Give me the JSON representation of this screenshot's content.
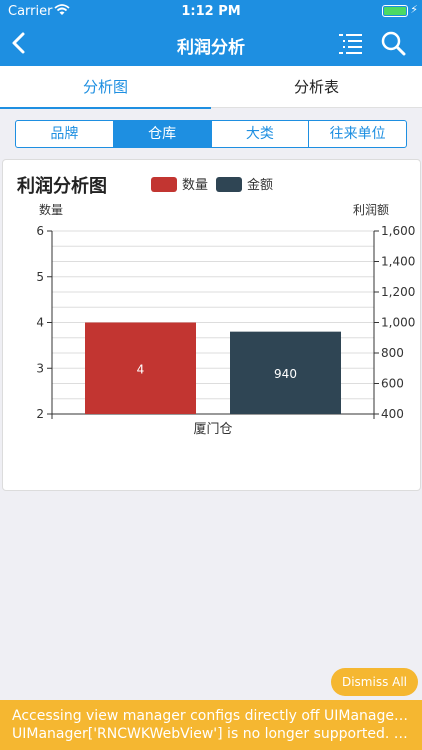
{
  "status_bar": {
    "carrier": "Carrier",
    "time": "1:12 PM"
  },
  "nav": {
    "title": "利润分析",
    "back_icon": "chevron-left-icon",
    "menu_icon": "list-icon",
    "search_icon": "search-icon"
  },
  "tabs": [
    {
      "label": "分析图",
      "active": true
    },
    {
      "label": "分析表",
      "active": false
    }
  ],
  "segments": [
    {
      "label": "品牌",
      "active": false
    },
    {
      "label": "仓库",
      "active": true
    },
    {
      "label": "大类",
      "active": false
    },
    {
      "label": "往来单位",
      "active": false
    }
  ],
  "chart_data": {
    "type": "bar",
    "title": "利润分析图",
    "categories": [
      "厦门仓"
    ],
    "series": [
      {
        "name": "数量",
        "values": [
          4
        ],
        "axis": "left",
        "color": "#c23531"
      },
      {
        "name": "金额",
        "values": [
          940
        ],
        "axis": "right",
        "color": "#2f4554"
      }
    ],
    "y_left": {
      "label": "数量",
      "range": [
        2,
        6
      ],
      "ticks": [
        "2",
        "3",
        "4",
        "5",
        "6"
      ]
    },
    "y_right": {
      "label": "利润额",
      "range": [
        400,
        1600
      ],
      "ticks": [
        "400",
        "600",
        "800",
        "1,000",
        "1,200",
        "1,400",
        "1,600"
      ]
    },
    "data_labels": [
      "4",
      "940"
    ],
    "grid": true,
    "legend": "top"
  },
  "dismiss": {
    "label": "Dismiss All"
  },
  "warning": {
    "line1": "Accessing view manager configs directly off UIManager via",
    "line2": "UIManager['RNCWKWebView'] is no longer supported. Us..."
  },
  "colors": {
    "primary": "#1e8fe1",
    "warning": "#f5b731"
  }
}
